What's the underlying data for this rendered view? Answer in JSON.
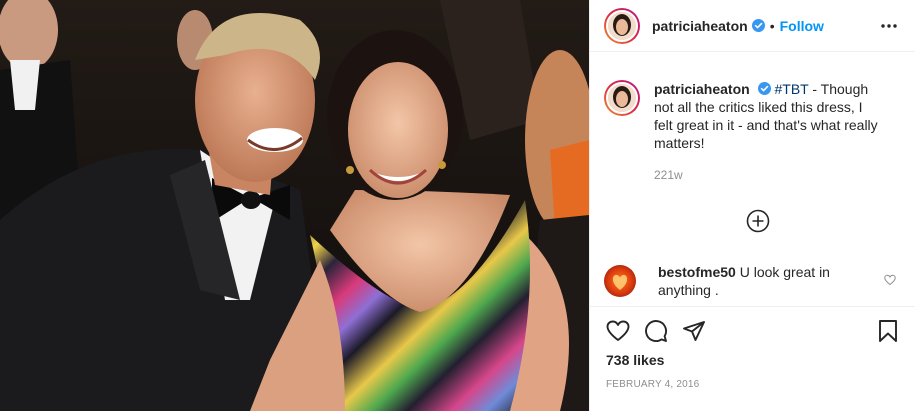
{
  "post": {
    "author": "patriciaheaton",
    "follow_label": "Follow",
    "separator": "•",
    "caption": {
      "username": "patriciaheaton",
      "hashtag": "#TBT",
      "text": " - Though not all the critics liked this dress, I felt great in it - and that's what really matters!",
      "age": "221w"
    },
    "comments": [
      {
        "username": "bestofme50",
        "text": " U look great in anything ."
      }
    ],
    "likes": "738 likes",
    "date": "February 4, 2016"
  },
  "icons": {
    "verified": "verified-badge-icon",
    "more": "more-options-icon",
    "load_more": "plus-circle-icon",
    "like": "heart-icon",
    "comment": "comment-icon",
    "share": "share-icon",
    "save": "bookmark-icon"
  },
  "colors": {
    "follow": "#0095f6",
    "verified": "#3897f0",
    "muted": "#8e8e8e",
    "hashtag": "#00376b"
  }
}
